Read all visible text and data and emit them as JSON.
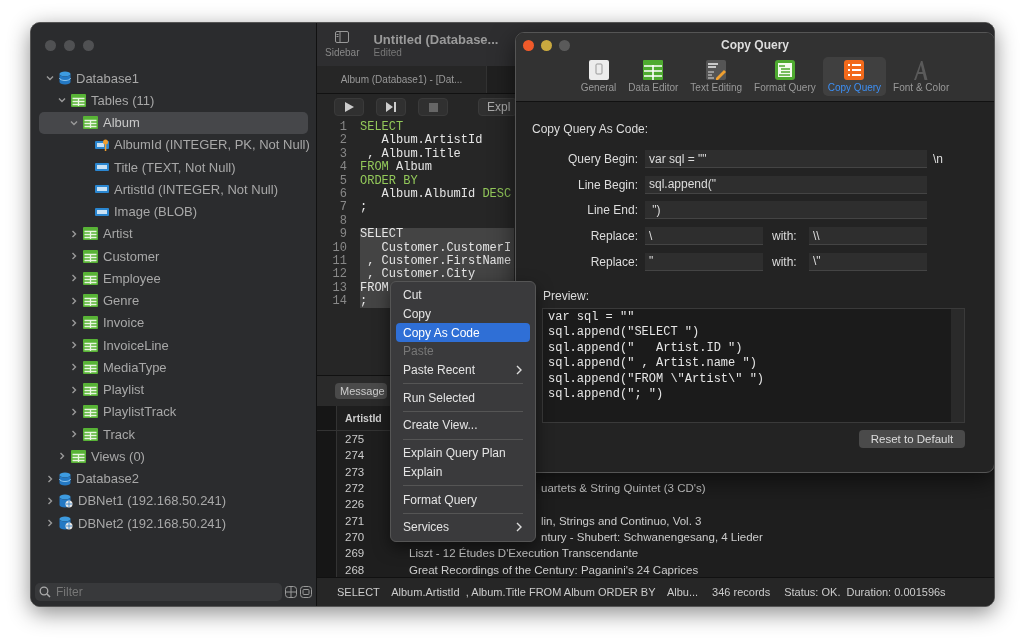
{
  "sidebar": {
    "tree": [
      {
        "label": "Database1",
        "kind": "database",
        "expanded": true,
        "selected": false,
        "children": [
          {
            "label": "Tables (11)",
            "kind": "table",
            "expanded": true,
            "selected": false,
            "children": [
              {
                "label": "Album",
                "kind": "table",
                "expanded": true,
                "selected": true,
                "children": [
                  {
                    "label": "AlbumId (INTEGER, PK, Not Null)",
                    "kind": "key-column",
                    "selected": false
                  },
                  {
                    "label": "Title (TEXT, Not Null)",
                    "kind": "column",
                    "selected": false
                  },
                  {
                    "label": "ArtistId (INTEGER, Not Null)",
                    "kind": "column",
                    "selected": false
                  },
                  {
                    "label": "Image (BLOB)",
                    "kind": "column",
                    "selected": false
                  }
                ]
              },
              {
                "label": "Artist",
                "kind": "table",
                "expanded": false,
                "selected": false
              },
              {
                "label": "Customer",
                "kind": "table",
                "expanded": false,
                "selected": false
              },
              {
                "label": "Employee",
                "kind": "table",
                "expanded": false,
                "selected": false
              },
              {
                "label": "Genre",
                "kind": "table",
                "expanded": false,
                "selected": false
              },
              {
                "label": "Invoice",
                "kind": "table",
                "expanded": false,
                "selected": false
              },
              {
                "label": "InvoiceLine",
                "kind": "table",
                "expanded": false,
                "selected": false
              },
              {
                "label": "MediaType",
                "kind": "table",
                "expanded": false,
                "selected": false
              },
              {
                "label": "Playlist",
                "kind": "table",
                "expanded": false,
                "selected": false
              },
              {
                "label": "PlaylistTrack",
                "kind": "table",
                "expanded": false,
                "selected": false
              },
              {
                "label": "Track",
                "kind": "table",
                "expanded": false,
                "selected": false
              }
            ]
          },
          {
            "label": "Views (0)",
            "kind": "table",
            "expanded": false,
            "selected": false
          }
        ]
      },
      {
        "label": "Database2",
        "kind": "database",
        "expanded": false,
        "selected": false
      },
      {
        "label": "DBNet1 (192.168.50.241)",
        "kind": "remote-database",
        "expanded": false,
        "selected": false
      },
      {
        "label": "DBNet2 (192.168.50.241)",
        "kind": "remote-database",
        "expanded": false,
        "selected": false
      }
    ],
    "filter": {
      "placeholder": "Filter"
    }
  },
  "toolbar": {
    "sidebar_button": "Sidebar",
    "title": "Untitled (Database...",
    "subtitle": "Edited"
  },
  "tabs": [
    {
      "label": "Album (Database1) - [Dat...",
      "selected": true
    }
  ],
  "editor_toolbar": {
    "explain_button": "Expl"
  },
  "code": [
    {
      "number": "1",
      "selected": false,
      "tokens": [
        {
          "kind": "keyword",
          "text": "SELECT"
        }
      ]
    },
    {
      "number": "2",
      "selected": false,
      "tokens": [
        {
          "kind": "plain",
          "text": "   Album.ArtistId"
        }
      ]
    },
    {
      "number": "3",
      "selected": false,
      "tokens": [
        {
          "kind": "plain",
          "text": " , Album.Title"
        }
      ]
    },
    {
      "number": "4",
      "selected": false,
      "tokens": [
        {
          "kind": "keyword",
          "text": "FROM"
        },
        {
          "kind": "plain",
          "text": " Album"
        }
      ]
    },
    {
      "number": "5",
      "selected": false,
      "tokens": [
        {
          "kind": "keyword",
          "text": "ORDER BY"
        }
      ]
    },
    {
      "number": "6",
      "selected": false,
      "tokens": [
        {
          "kind": "plain",
          "text": "   Album.AlbumId "
        },
        {
          "kind": "keyword",
          "text": "DESC"
        }
      ]
    },
    {
      "number": "7",
      "selected": false,
      "tokens": [
        {
          "kind": "plain",
          "text": ";"
        }
      ]
    },
    {
      "number": "8"
    },
    {
      "number": "9",
      "selected": true,
      "tokens": [
        {
          "kind": "plain",
          "text": "SELECT"
        }
      ]
    },
    {
      "number": "10",
      "selected": true,
      "tokens": [
        {
          "kind": "plain",
          "text": "   Customer.CustomerI"
        }
      ]
    },
    {
      "number": "11",
      "selected": true,
      "tokens": [
        {
          "kind": "plain",
          "text": " , Customer.FirstName"
        }
      ]
    },
    {
      "number": "12",
      "selected": true,
      "tokens": [
        {
          "kind": "plain",
          "text": " , Customer.City"
        }
      ]
    },
    {
      "number": "13",
      "selected": true,
      "tokens": [
        {
          "kind": "plain",
          "text": "FROM"
        }
      ]
    },
    {
      "number": "14",
      "selected": true,
      "tokens": [
        {
          "kind": "plain",
          "text": ";"
        }
      ]
    }
  ],
  "results": {
    "tab": "Message",
    "columns": [
      "ArtistId"
    ],
    "rows": [
      {
        "artist_id": "275"
      },
      {
        "artist_id": "274"
      },
      {
        "artist_id": "273"
      },
      {
        "artist_id": "272",
        "title": "uartets & String Quintet (3 CD's)",
        "covered": true
      },
      {
        "artist_id": "226"
      },
      {
        "artist_id": "271",
        "title": "lin, Strings and Continuo, Vol. 3",
        "covered": true
      },
      {
        "artist_id": "270",
        "title": "ntury - Shubert: Schwanengesang, 4 Lieder",
        "covered": true
      },
      {
        "artist_id": "269",
        "title": "Liszt - 12 Études D'Execution Transcendante"
      },
      {
        "artist_id": "268",
        "title": "Great Recordings of the Century: Paganini's 24 Caprices"
      }
    ]
  },
  "status_bar": {
    "query": "SELECT    Album.ArtistId  , Album.Title FROM Album ORDER BY    Albu...",
    "records": "346 records",
    "status": "Status: OK.  Duration: 0.001596s"
  },
  "context_menu": [
    {
      "kind": "item",
      "label": "Cut",
      "disabled": false,
      "selected": false,
      "submenu": false
    },
    {
      "kind": "item",
      "label": "Copy",
      "disabled": false,
      "selected": false,
      "submenu": false
    },
    {
      "kind": "item",
      "label": "Copy As Code",
      "disabled": false,
      "selected": true,
      "submenu": false
    },
    {
      "kind": "item",
      "label": "Paste",
      "disabled": true,
      "selected": false,
      "submenu": false
    },
    {
      "kind": "item",
      "label": "Paste Recent",
      "disabled": false,
      "selected": false,
      "submenu": true
    },
    {
      "kind": "separator"
    },
    {
      "kind": "item",
      "label": "Run Selected",
      "disabled": false,
      "selected": false,
      "submenu": false
    },
    {
      "kind": "separator"
    },
    {
      "kind": "item",
      "label": "Create View...",
      "disabled": false,
      "selected": false,
      "submenu": false
    },
    {
      "kind": "separator"
    },
    {
      "kind": "item",
      "label": "Explain Query Plan",
      "disabled": false,
      "selected": false,
      "submenu": false
    },
    {
      "kind": "item",
      "label": "Explain",
      "disabled": false,
      "selected": false,
      "submenu": false
    },
    {
      "kind": "separator"
    },
    {
      "kind": "item",
      "label": "Format Query",
      "disabled": false,
      "selected": false,
      "submenu": false
    },
    {
      "kind": "separator"
    },
    {
      "kind": "item",
      "label": "Services",
      "disabled": false,
      "selected": false,
      "submenu": true
    }
  ],
  "dialog": {
    "title": "Copy Query",
    "tabs": [
      {
        "label": "General",
        "kind": "general",
        "selected": false
      },
      {
        "label": "Data Editor",
        "kind": "data-editor",
        "selected": false
      },
      {
        "label": "Text Editing",
        "kind": "text-editing",
        "selected": false
      },
      {
        "label": "Format Query",
        "kind": "format-query",
        "selected": false
      },
      {
        "label": "Copy Query",
        "kind": "copy-query",
        "selected": true
      },
      {
        "label": "Font & Color",
        "kind": "font-color",
        "selected": false
      }
    ],
    "heading": "Copy Query As Code:",
    "fields": [
      {
        "label": "Query Begin:",
        "value": "var sql = \"\"",
        "suffix": "\\n"
      },
      {
        "label": "Line Begin:",
        "value": "sql.append(\""
      },
      {
        "label": "Line End:",
        "value": " \")"
      }
    ],
    "replacements": [
      {
        "label": "Replace:",
        "value": "\\",
        "with_label": "with:",
        "with_value": "\\\\"
      },
      {
        "label": "Replace:",
        "value": "\"",
        "with_label": "with:",
        "with_value": "\\\""
      }
    ],
    "preview_label": "Preview:",
    "preview_lines": [
      "var sql = \"\"",
      "sql.append(\"SELECT \")",
      "sql.append(\"   Artist.ID \")",
      "sql.append(\" , Artist.name \")",
      "sql.append(\"FROM \\\"Artist\\\" \")",
      "sql.append(\"; \")"
    ],
    "reset_button": "Reset to Default"
  }
}
